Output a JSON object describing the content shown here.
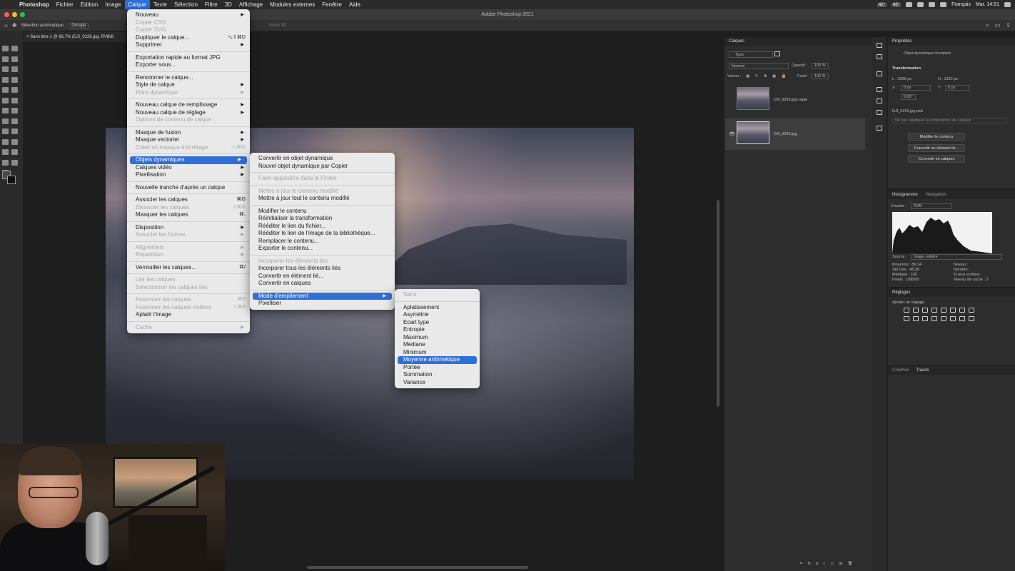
{
  "menubar": {
    "app": "Photoshop",
    "items": [
      "Fichier",
      "Edition",
      "Image",
      "Calque",
      "Texte",
      "Sélection",
      "Filtre",
      "3D",
      "Affichage",
      "Modules externes",
      "Fenêtre",
      "Aide"
    ],
    "active": "Calque",
    "status": {
      "temp1": "42°",
      "temp2": "45°",
      "lang": "Français",
      "clock": "Mar. 14:51"
    }
  },
  "window": {
    "title": "Adobe Photoshop 2021"
  },
  "options": {
    "auto_select": "Sélection automatique :",
    "group": "Groupe",
    "mode3d": "Mode 3D :"
  },
  "doc": {
    "tab": "Sans titre-1 @ 66,7% (DJI_0226.jpg, RVB/8"
  },
  "calque_menu": [
    {
      "label": "Nouveau",
      "arrow": true
    },
    {
      "label": "Copier CSS",
      "disabled": true
    },
    {
      "label": "Copier SVG",
      "disabled": true
    },
    {
      "label": "Dupliquer le calque...",
      "shortcut": "⌥⇧⌘D"
    },
    {
      "label": "Supprimer",
      "arrow": true
    },
    {
      "sep": true
    },
    {
      "label": "Exportation rapide au format JPG"
    },
    {
      "label": "Exporter sous..."
    },
    {
      "sep": true
    },
    {
      "label": "Renommer le calque..."
    },
    {
      "label": "Style de calque",
      "arrow": true
    },
    {
      "label": "Filtre dynamique",
      "disabled": true,
      "arrow": true
    },
    {
      "sep": true
    },
    {
      "label": "Nouveau calque de remplissage",
      "arrow": true
    },
    {
      "label": "Nouveau calque de réglage",
      "arrow": true
    },
    {
      "label": "Options de contenu de calque...",
      "disabled": true
    },
    {
      "sep": true
    },
    {
      "label": "Masque de fusion",
      "arrow": true
    },
    {
      "label": "Masque vectoriel",
      "arrow": true
    },
    {
      "label": "Créer un masque d'écrêtage",
      "disabled": true,
      "shortcut": "⌥⌘G"
    },
    {
      "sep": true
    },
    {
      "label": "Objets dynamiques",
      "arrow": true,
      "highlight": true
    },
    {
      "label": "Calques vidéo",
      "arrow": true
    },
    {
      "label": "Pixellisation",
      "arrow": true
    },
    {
      "sep": true
    },
    {
      "label": "Nouvelle tranche d'après un calque"
    },
    {
      "sep": true
    },
    {
      "label": "Associer les calques",
      "shortcut": "⌘G"
    },
    {
      "label": "Dissocier les calques",
      "disabled": true,
      "shortcut": "⇧⌘G"
    },
    {
      "label": "Masquer les calques",
      "shortcut": "⌘,"
    },
    {
      "sep": true
    },
    {
      "label": "Disposition",
      "arrow": true
    },
    {
      "label": "Associer les formes",
      "disabled": true,
      "arrow": true
    },
    {
      "sep": true
    },
    {
      "label": "Alignement",
      "disabled": true,
      "arrow": true
    },
    {
      "label": "Répartition",
      "disabled": true,
      "arrow": true
    },
    {
      "sep": true
    },
    {
      "label": "Verrouiller les calques...",
      "shortcut": "⌘/"
    },
    {
      "sep": true
    },
    {
      "label": "Lier les calques",
      "disabled": true
    },
    {
      "label": "Sélectionner les calques liés",
      "disabled": true
    },
    {
      "sep": true
    },
    {
      "label": "Fusionner les calques",
      "disabled": true,
      "shortcut": "⌘E"
    },
    {
      "label": "Fusionner les calques visibles",
      "disabled": true,
      "shortcut": "⇧⌘E"
    },
    {
      "label": "Aplatir l'image"
    },
    {
      "sep": true
    },
    {
      "label": "Cache",
      "disabled": true,
      "arrow": true
    }
  ],
  "smart_menu": [
    {
      "label": "Convertir en objet dynamique"
    },
    {
      "label": "Nouvel objet dynamique par Copier"
    },
    {
      "sep": true
    },
    {
      "label": "Faire apparaître dans le Finder",
      "disabled": true
    },
    {
      "sep": true
    },
    {
      "label": "Mettre à jour le contenu modifié",
      "disabled": true
    },
    {
      "label": "Mettre à jour tout le contenu modifié"
    },
    {
      "sep": true
    },
    {
      "label": "Modifier le contenu"
    },
    {
      "label": "Réinitialiser la transformation"
    },
    {
      "label": "Rééditer le lien du fichier..."
    },
    {
      "label": "Rééditer le lien de l'image de la bibliothèque..."
    },
    {
      "label": "Remplacer le contenu..."
    },
    {
      "label": "Exporter le contenu..."
    },
    {
      "sep": true
    },
    {
      "label": "Incorporer les éléments liés",
      "disabled": true
    },
    {
      "label": "Incorporer tous les éléments liés"
    },
    {
      "label": "Convertir en élément lié..."
    },
    {
      "label": "Convertir en calques"
    },
    {
      "sep": true
    },
    {
      "label": "Mode d'empilement",
      "arrow": true,
      "highlight": true
    },
    {
      "label": "Pixelliser"
    }
  ],
  "stack_menu": [
    {
      "label": "Sans",
      "disabled": true
    },
    {
      "sep": true
    },
    {
      "label": "Aplatissement"
    },
    {
      "label": "Asymétrie"
    },
    {
      "label": "Ecart type"
    },
    {
      "label": "Entropie"
    },
    {
      "label": "Maximum"
    },
    {
      "label": "Médiane"
    },
    {
      "label": "Minimum"
    },
    {
      "label": "Moyenne arithmétique",
      "highlight": true
    },
    {
      "label": "Portée"
    },
    {
      "label": "Sommation"
    },
    {
      "label": "Variance"
    }
  ],
  "layers": {
    "title": "Calques",
    "kind": "Type",
    "blend": "Normal",
    "opacity_label": "Opacité :",
    "opacity": "100 %",
    "lock_label": "Verrou :",
    "fill_label": "Fond :",
    "fill": "100 %",
    "rows": [
      {
        "name": "DJI_0226.jpg copie"
      },
      {
        "name": "DJI_0226.jpg"
      }
    ]
  },
  "properties": {
    "title": "Propriétés",
    "type": "Objet dynamique incorporé",
    "transform": "Transformation",
    "L": "L : 2000 px",
    "H": "H : 1332 px",
    "X": "X :",
    "X_val": "0 px",
    "Y": "Y :",
    "Y_val": "0 px",
    "angle": "0,00°",
    "file": "DJI_0226.jpg.psb",
    "comp": "Ne pas appliquer la composition de calques",
    "buttons": [
      "Modifier le contenu",
      "Convertir en élément lié...",
      "Convertir en calques"
    ]
  },
  "histogram": {
    "tabs": [
      "Histogramme",
      "Navigation"
    ],
    "channel_label": "Couche :",
    "channel": "RVB",
    "source_label": "Source :",
    "source": "Image entière",
    "stats_left": [
      "Moyenne : 89,14",
      "Std Dev : 48,38",
      "Médiane : 102",
      "Pixels : 168500"
    ],
    "stats_right": [
      "Niveau :",
      "Nombre :",
      "% plus sombre :",
      "Niveau de cache : 3"
    ]
  },
  "adjustments": {
    "title": "Réglages",
    "add": "Ajouter un réglage"
  },
  "bottom_tabs": [
    "Couches",
    "Tracés"
  ]
}
